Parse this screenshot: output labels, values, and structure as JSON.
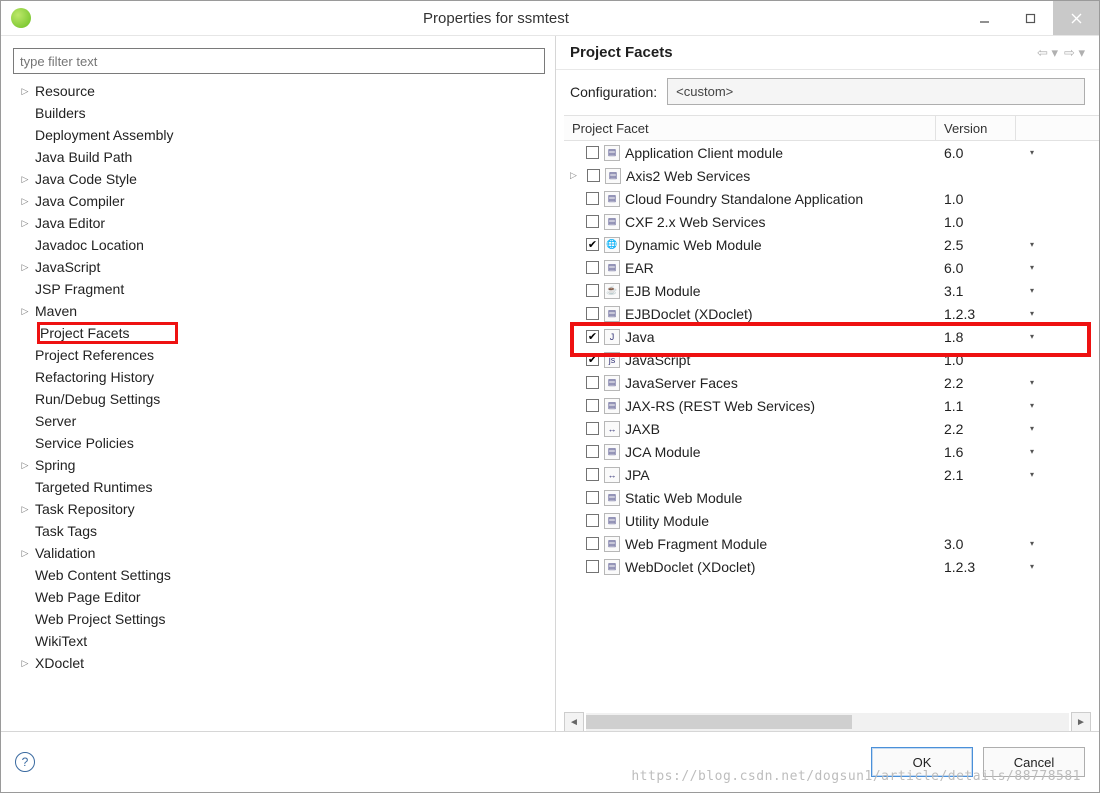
{
  "titlebar": {
    "title": "Properties for ssmtest"
  },
  "filter": {
    "placeholder": "type filter text"
  },
  "tree": [
    {
      "label": "Resource",
      "expandable": true
    },
    {
      "label": "Builders",
      "expandable": false
    },
    {
      "label": "Deployment Assembly",
      "expandable": false
    },
    {
      "label": "Java Build Path",
      "expandable": false
    },
    {
      "label": "Java Code Style",
      "expandable": true
    },
    {
      "label": "Java Compiler",
      "expandable": true
    },
    {
      "label": "Java Editor",
      "expandable": true
    },
    {
      "label": "Javadoc Location",
      "expandable": false
    },
    {
      "label": "JavaScript",
      "expandable": true
    },
    {
      "label": "JSP Fragment",
      "expandable": false
    },
    {
      "label": "Maven",
      "expandable": true
    },
    {
      "label": "Project Facets",
      "expandable": false,
      "highlight": true
    },
    {
      "label": "Project References",
      "expandable": false
    },
    {
      "label": "Refactoring History",
      "expandable": false
    },
    {
      "label": "Run/Debug Settings",
      "expandable": false
    },
    {
      "label": "Server",
      "expandable": false
    },
    {
      "label": "Service Policies",
      "expandable": false
    },
    {
      "label": "Spring",
      "expandable": true
    },
    {
      "label": "Targeted Runtimes",
      "expandable": false
    },
    {
      "label": "Task Repository",
      "expandable": true
    },
    {
      "label": "Task Tags",
      "expandable": false
    },
    {
      "label": "Validation",
      "expandable": true
    },
    {
      "label": "Web Content Settings",
      "expandable": false
    },
    {
      "label": "Web Page Editor",
      "expandable": false
    },
    {
      "label": "Web Project Settings",
      "expandable": false
    },
    {
      "label": "WikiText",
      "expandable": false
    },
    {
      "label": "XDoclet",
      "expandable": true
    }
  ],
  "right": {
    "heading": "Project Facets",
    "config_label": "Configuration:",
    "config_value": "<custom>",
    "col_facet": "Project Facet",
    "col_version": "Version"
  },
  "facets": [
    {
      "name": "Application Client module",
      "version": "6.0",
      "checked": false,
      "dd": true,
      "glyph": "▤"
    },
    {
      "name": "Axis2 Web Services",
      "version": "",
      "checked": false,
      "dd": false,
      "glyph": "▤",
      "expandable": true
    },
    {
      "name": "Cloud Foundry Standalone Application",
      "version": "1.0",
      "checked": false,
      "dd": false,
      "glyph": "▤"
    },
    {
      "name": "CXF 2.x Web Services",
      "version": "1.0",
      "checked": false,
      "dd": false,
      "glyph": "▤"
    },
    {
      "name": "Dynamic Web Module",
      "version": "2.5",
      "checked": true,
      "dd": true,
      "glyph": "🌐"
    },
    {
      "name": "EAR",
      "version": "6.0",
      "checked": false,
      "dd": true,
      "glyph": "▤"
    },
    {
      "name": "EJB Module",
      "version": "3.1",
      "checked": false,
      "dd": true,
      "glyph": "☕"
    },
    {
      "name": "EJBDoclet (XDoclet)",
      "version": "1.2.3",
      "checked": false,
      "dd": true,
      "glyph": "▤"
    },
    {
      "name": "Java",
      "version": "1.8",
      "checked": true,
      "dd": true,
      "glyph": "J",
      "highlight": true
    },
    {
      "name": "JavaScript",
      "version": "1.0",
      "checked": true,
      "dd": false,
      "glyph": "js"
    },
    {
      "name": "JavaServer Faces",
      "version": "2.2",
      "checked": false,
      "dd": true,
      "glyph": "▤"
    },
    {
      "name": "JAX-RS (REST Web Services)",
      "version": "1.1",
      "checked": false,
      "dd": true,
      "glyph": "▤"
    },
    {
      "name": "JAXB",
      "version": "2.2",
      "checked": false,
      "dd": true,
      "glyph": "↔"
    },
    {
      "name": "JCA Module",
      "version": "1.6",
      "checked": false,
      "dd": true,
      "glyph": "▤"
    },
    {
      "name": "JPA",
      "version": "2.1",
      "checked": false,
      "dd": true,
      "glyph": "↔"
    },
    {
      "name": "Static Web Module",
      "version": "",
      "checked": false,
      "dd": false,
      "glyph": "▤"
    },
    {
      "name": "Utility Module",
      "version": "",
      "checked": false,
      "dd": false,
      "glyph": "▤"
    },
    {
      "name": "Web Fragment Module",
      "version": "3.0",
      "checked": false,
      "dd": true,
      "glyph": "▤"
    },
    {
      "name": "WebDoclet (XDoclet)",
      "version": "1.2.3",
      "checked": false,
      "dd": true,
      "glyph": "▤"
    }
  ],
  "buttons": {
    "ok": "OK",
    "cancel": "Cancel"
  },
  "watermark": "https://blog.csdn.net/dogsun1/article/details/88778581"
}
